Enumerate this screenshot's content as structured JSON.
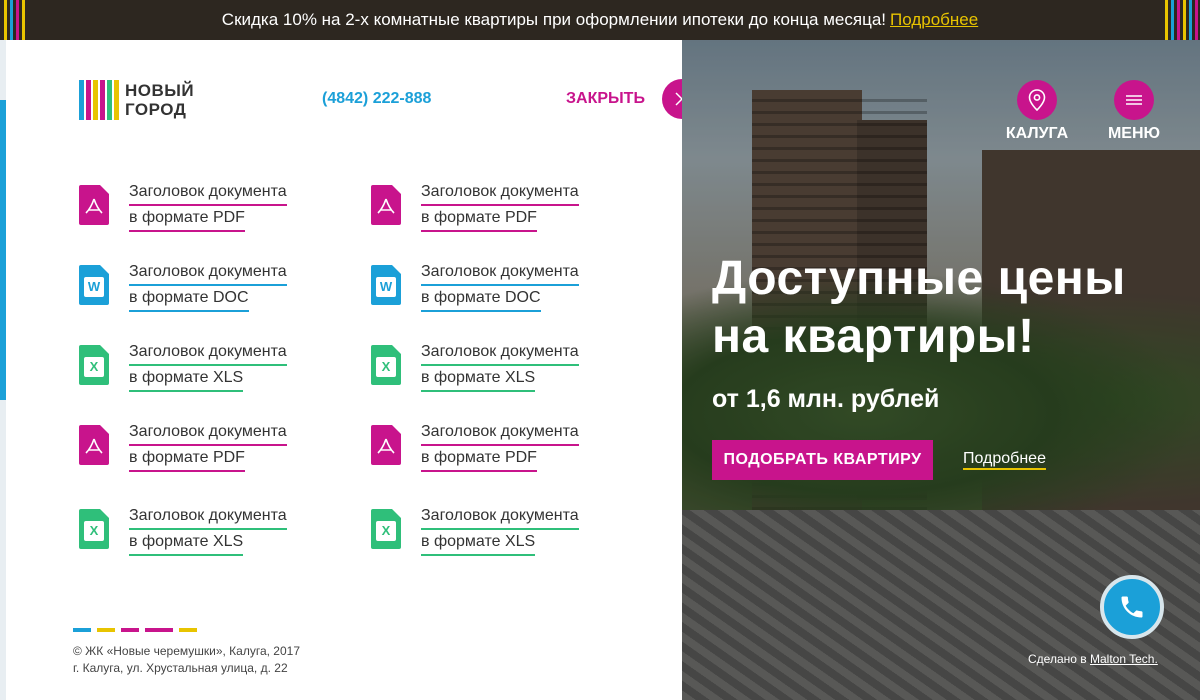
{
  "banner": {
    "text": "Скидка 10% на 2-х комнатные квартиры при оформлении ипотеки до конца месяца!",
    "link": "Подробнее"
  },
  "logo": {
    "line1": "НОВЫЙ",
    "line2": "ГОРОД"
  },
  "header": {
    "phone": "(4842) 222-888",
    "close_label": "ЗАКРЫТЬ",
    "city_label": "КАЛУГА",
    "menu_label": "МЕНЮ"
  },
  "documents": [
    {
      "line1": "Заголовок документа",
      "line2": "в формате PDF",
      "type": "pdf",
      "icon": "pdf-file-icon"
    },
    {
      "line1": "Заголовок документа",
      "line2": "в формате PDF",
      "type": "pdf",
      "icon": "pdf-file-icon"
    },
    {
      "line1": "Заголовок документа",
      "line2": "в формате DOC",
      "type": "doc",
      "icon": "word-file-icon"
    },
    {
      "line1": "Заголовок документа",
      "line2": "в формате DOC",
      "type": "doc",
      "icon": "word-file-icon"
    },
    {
      "line1": "Заголовок документа",
      "line2": "в формате XLS",
      "type": "xls",
      "icon": "excel-file-icon"
    },
    {
      "line1": "Заголовок документа",
      "line2": "в формате XLS",
      "type": "xls",
      "icon": "excel-file-icon"
    },
    {
      "line1": "Заголовок документа",
      "line2": "в формате PDF",
      "type": "pdf",
      "icon": "pdf-file-icon"
    },
    {
      "line1": "Заголовок документа",
      "line2": "в формате PDF",
      "type": "pdf",
      "icon": "pdf-file-icon"
    },
    {
      "line1": "Заголовок документа",
      "line2": "в формате XLS",
      "type": "xls",
      "icon": "excel-file-icon"
    },
    {
      "line1": "Заголовок документа",
      "line2": "в формате XLS",
      "type": "xls",
      "icon": "excel-file-icon"
    }
  ],
  "footer": {
    "line1": "© ЖК «Новые черемушки», Калуга, 2017",
    "line2": "г. Калуга, ул. Хрустальная улица, д. 22"
  },
  "hero": {
    "headline_line1": "Доступные цены",
    "headline_line2": "на квартиры!",
    "subline": "от 1,6 млн. рублей",
    "cta": "ПОДОБРАТЬ КВАРТИРУ",
    "more": "Подробнее"
  },
  "credit": {
    "prefix": "Сделано в",
    "link": "Malton Tech."
  },
  "colors": {
    "magenta": "#c8148c",
    "blue": "#1ba0d8",
    "yellow": "#e8c400",
    "green": "#2fbf7a",
    "dark": "#2d2720"
  }
}
